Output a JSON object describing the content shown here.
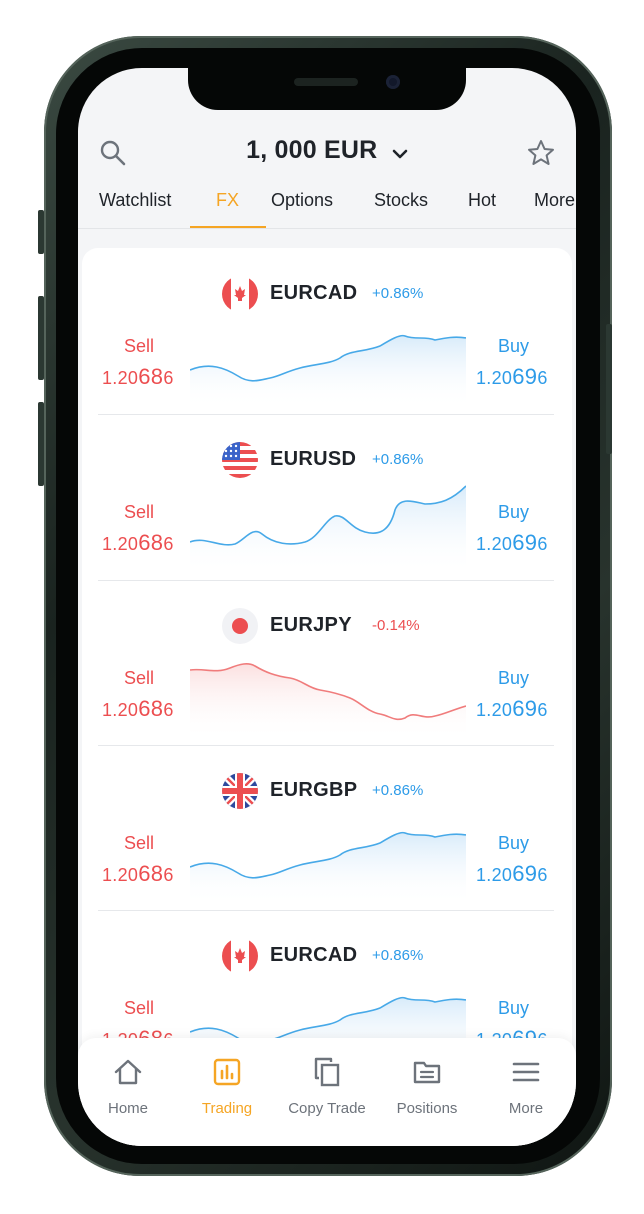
{
  "header": {
    "balance": "1, 000 EUR",
    "search_icon": "search-icon",
    "dropdown_icon": "chevron-down-icon",
    "favorite_icon": "star-icon"
  },
  "tabs": [
    {
      "label": "Watchlist",
      "active": false
    },
    {
      "label": "FX",
      "active": true
    },
    {
      "label": "Options",
      "active": false
    },
    {
      "label": "Stocks",
      "active": false
    },
    {
      "label": "Hot",
      "active": false
    },
    {
      "label": "More",
      "active": false
    }
  ],
  "pairs": [
    {
      "name": "EURCAD",
      "change": "+0.86%",
      "trend": "up",
      "flag": "canada-flag-icon",
      "sell_label": "Sell",
      "sell_price_main": "1.20",
      "sell_price_big": "68",
      "sell_price_tail": "6",
      "buy_label": "Buy",
      "buy_price_main": "1.20",
      "buy_price_big": "69",
      "buy_price_tail": "6"
    },
    {
      "name": "EURUSD",
      "change": "+0.86%",
      "trend": "up",
      "flag": "usa-flag-icon",
      "sell_label": "Sell",
      "sell_price_main": "1.20",
      "sell_price_big": "68",
      "sell_price_tail": "6",
      "buy_label": "Buy",
      "buy_price_main": "1.20",
      "buy_price_big": "69",
      "buy_price_tail": "6"
    },
    {
      "name": "EURJPY",
      "change": "-0.14%",
      "trend": "down",
      "flag": "japan-flag-icon",
      "sell_label": "Sell",
      "sell_price_main": "1.20",
      "sell_price_big": "68",
      "sell_price_tail": "6",
      "buy_label": "Buy",
      "buy_price_main": "1.20",
      "buy_price_big": "69",
      "buy_price_tail": "6"
    },
    {
      "name": "EURGBP",
      "change": "+0.86%",
      "trend": "up",
      "flag": "uk-flag-icon",
      "sell_label": "Sell",
      "sell_price_main": "1.20",
      "sell_price_big": "68",
      "sell_price_tail": "6",
      "buy_label": "Buy",
      "buy_price_main": "1.20",
      "buy_price_big": "69",
      "buy_price_tail": "6"
    },
    {
      "name": "EURCAD",
      "change": "+0.86%",
      "trend": "up",
      "flag": "canada-flag-icon",
      "sell_label": "Sell",
      "sell_price_main": "1.20",
      "sell_price_big": "68",
      "sell_price_tail": "6",
      "buy_label": "Buy",
      "buy_price_main": "1.20",
      "buy_price_big": "69",
      "buy_price_tail": "6"
    }
  ],
  "colors": {
    "accent": "#f5a524",
    "sell": "#ec4e50",
    "buy": "#2d9be8",
    "up_line": "#47a9e8",
    "down_line": "#f07c7c"
  },
  "bottom_nav": [
    {
      "label": "Home",
      "icon": "home-icon",
      "active": false
    },
    {
      "label": "Trading",
      "icon": "trading-chart-icon",
      "active": true
    },
    {
      "label": "Copy Trade",
      "icon": "copy-icon",
      "active": false
    },
    {
      "label": "Positions",
      "icon": "folder-icon",
      "active": false
    },
    {
      "label": "More",
      "icon": "menu-icon",
      "active": false
    }
  ]
}
